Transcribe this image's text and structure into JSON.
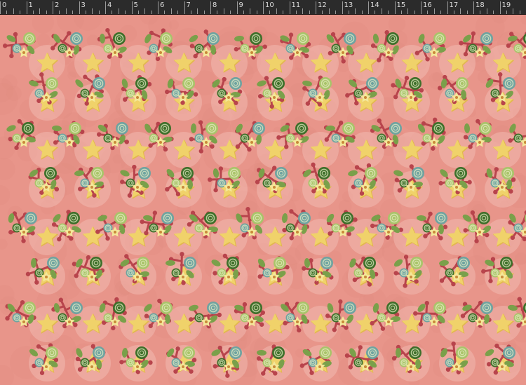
{
  "ruler": {
    "labels": [
      "0",
      "1",
      "2",
      "3",
      "4",
      "5",
      "6",
      "7",
      "8",
      "9",
      "10",
      "11",
      "12",
      "13",
      "14",
      "15",
      "16",
      "17",
      "18",
      "19"
    ]
  },
  "colors": {
    "ruler_bg": "#2b2b2b",
    "ruler_text": "#dcdcdc",
    "fabric_bg": "#e8958a",
    "fabric_shade": "#de8a80",
    "star": "#f0d26a",
    "star_shadow": "#e2b84e",
    "star_glow": "#f3c2b7",
    "sprig": "#b8444c",
    "rose_dark": "#3e6f2a",
    "rose_light": "#a9c46a",
    "rose_teal": "#6fa3a0",
    "leaf": "#7aa04a",
    "blossom": "#f4e79a"
  },
  "pattern": {
    "name": "pink-floral-star-fabric",
    "icons": [
      "star-motif-icon",
      "rosette-motif-icon",
      "sprig-motif-icon",
      "blossom-motif-icon"
    ]
  }
}
